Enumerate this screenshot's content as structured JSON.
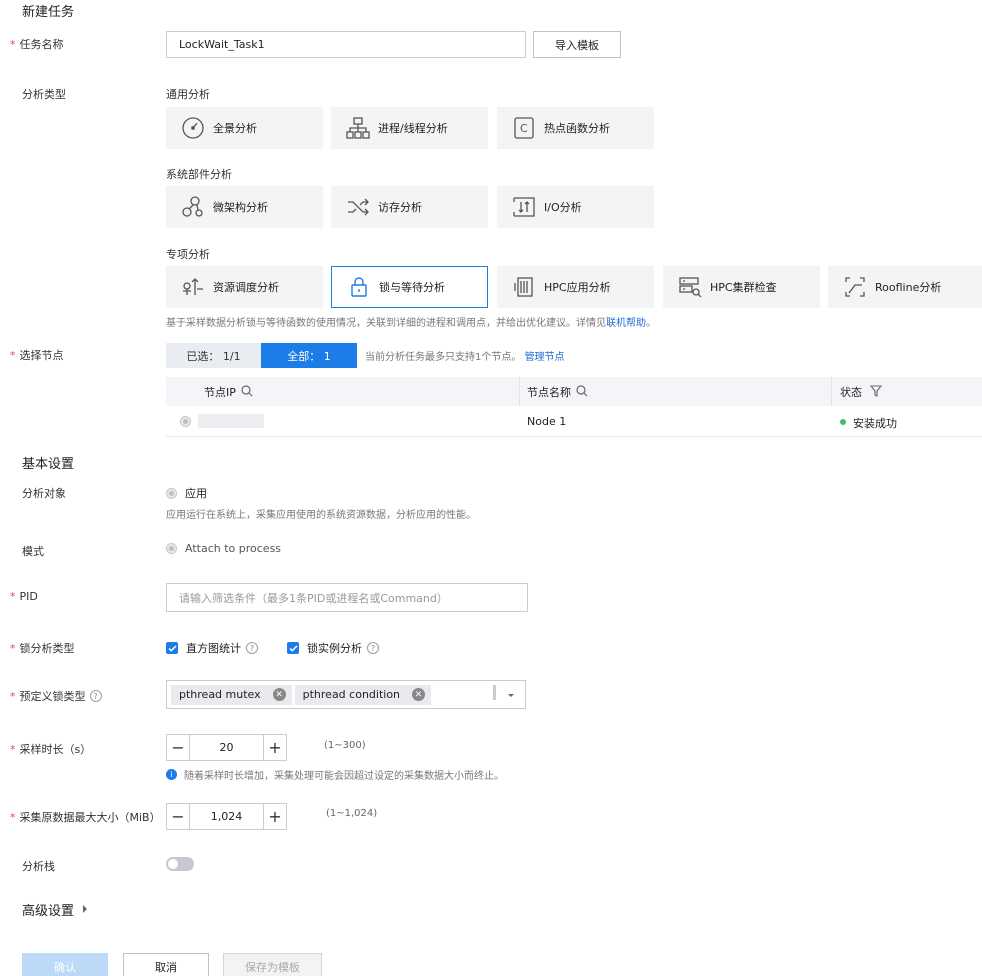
{
  "page_title": "新建任务",
  "task_name": {
    "label": "任务名称",
    "value": "LockWait_Task1",
    "import_button": "导入模板"
  },
  "analysis_type": {
    "label": "分析类型",
    "groups": [
      {
        "name": "通用分析",
        "items": [
          "全景分析",
          "进程/线程分析",
          "热点函数分析"
        ]
      },
      {
        "name": "系统部件分析",
        "items": [
          "微架构分析",
          "访存分析",
          "I/O分析"
        ]
      },
      {
        "name": "专项分析",
        "items": [
          "资源调度分析",
          "锁与等待分析",
          "HPC应用分析",
          "HPC集群检查",
          "Roofline分析"
        ]
      }
    ],
    "selected": "锁与等待分析",
    "description": "基于采样数据分析锁与等待函数的使用情况，关联到详细的进程和调用点，并给出优化建议。详情见",
    "help_link": "联机帮助",
    "description_end": "。"
  },
  "node_select": {
    "label": "选择节点",
    "tab_selected": "已选： 1/1",
    "tab_all": "全部： 1",
    "tip": "当前分析任务最多只支持1个节点。",
    "manage_link": "管理节点",
    "columns": [
      "节点IP",
      "节点名称",
      "状态"
    ],
    "rows": [
      {
        "ip": "",
        "name": "Node 1",
        "status": "安装成功"
      }
    ],
    "status_color": "#3cc065"
  },
  "basic_settings": {
    "title": "基本设置",
    "target_label": "分析对象",
    "target_value": "应用",
    "target_hint": "应用运行在系统上，采集应用使用的系统资源数据，分析应用的性能。",
    "mode_label": "模式",
    "mode_value": "Attach to process",
    "pid_label": "PID",
    "pid_placeholder": "请输入筛选条件（最多1条PID或进程名或Command）",
    "lock_type_label": "锁分析类型",
    "lock_type_options": [
      "直方图统计",
      "锁实例分析"
    ],
    "predef_label": "预定义锁类型",
    "predef_tags": [
      "pthread mutex",
      "pthread condition"
    ],
    "duration_label": "采样时长（s）",
    "duration_value": "20",
    "duration_range": "(1~300)",
    "duration_hint": "随着采样时长增加，采集处理可能会因超过设定的采集数据大小而终止。",
    "size_label": "采集原数据最大大小（MiB）",
    "size_value": "1,024",
    "size_range": "(1~1,024)",
    "stack_label": "分析栈",
    "stack_enabled": false
  },
  "advanced_settings": {
    "title": "高级设置"
  },
  "footer": {
    "confirm": "确认",
    "cancel": "取消",
    "save_template": "保存为模板"
  },
  "colors": {
    "primary": "#1c7ce8",
    "required": "#e54545"
  }
}
